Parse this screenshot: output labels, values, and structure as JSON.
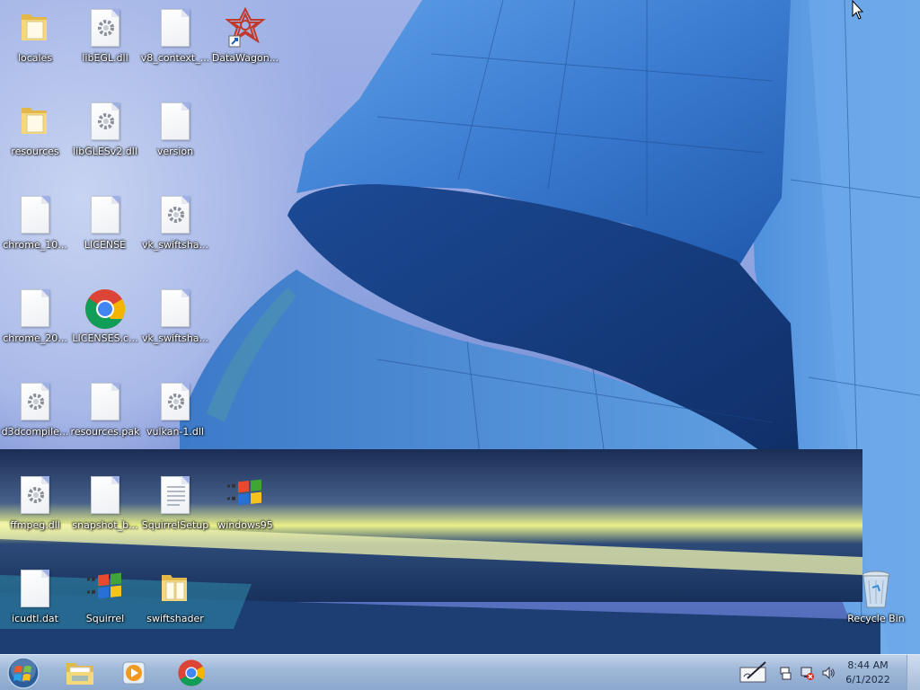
{
  "desktop": {
    "icons": [
      {
        "label": "locales",
        "icon": "folder-icon"
      },
      {
        "label": "libEGL.dll",
        "icon": "dll-file-icon"
      },
      {
        "label": "v8_context_...",
        "icon": "blank-file-icon"
      },
      {
        "label": "DataWagon...",
        "icon": "datawagon-shortcut-icon"
      },
      {
        "label": "resources",
        "icon": "folder-icon"
      },
      {
        "label": "libGLESv2.dll",
        "icon": "dll-file-icon"
      },
      {
        "label": "version",
        "icon": "blank-file-icon"
      },
      {
        "label": "chrome_10...",
        "icon": "blank-file-icon"
      },
      {
        "label": "LICENSE",
        "icon": "blank-file-icon"
      },
      {
        "label": "vk_swiftsha...",
        "icon": "dll-file-icon"
      },
      {
        "label": "chrome_20...",
        "icon": "blank-file-icon"
      },
      {
        "label": "LICENSES.c...",
        "icon": "chrome-icon"
      },
      {
        "label": "vk_swiftsha...",
        "icon": "blank-file-icon"
      },
      {
        "label": "d3dcompile...",
        "icon": "dll-file-icon"
      },
      {
        "label": "resources.pak",
        "icon": "blank-file-icon"
      },
      {
        "label": "vulkan-1.dll",
        "icon": "dll-file-icon"
      },
      {
        "label": "ffmpeg.dll",
        "icon": "dll-file-icon"
      },
      {
        "label": "snapshot_b...",
        "icon": "blank-file-icon"
      },
      {
        "label": "SquirrelSetup",
        "icon": "text-file-icon"
      },
      {
        "label": "windows95",
        "icon": "windows-logo-icon"
      },
      {
        "label": "icudtl.dat",
        "icon": "blank-file-icon"
      },
      {
        "label": "Squirrel",
        "icon": "windows-logo-icon"
      },
      {
        "label": "swiftshader",
        "icon": "folder-icon"
      },
      {
        "label": "Recycle Bin",
        "icon": "recycle-bin-icon"
      }
    ]
  },
  "taskbar": {
    "start_icon": "windows-start-orb-icon",
    "pinned": [
      {
        "name": "file-explorer",
        "icon": "folder-icon"
      },
      {
        "name": "media-player",
        "icon": "media-player-icon"
      },
      {
        "name": "chrome",
        "icon": "chrome-icon"
      }
    ],
    "tray": {
      "icons": [
        "action-center-icon",
        "network-icon",
        "volume-icon"
      ],
      "time": "8:44 AM",
      "date": "6/1/2022"
    }
  },
  "colors": {
    "taskbar": "#9fb8d8",
    "desktop_sky": "#9fb1e6",
    "building_blue": "#2f6fc0"
  }
}
